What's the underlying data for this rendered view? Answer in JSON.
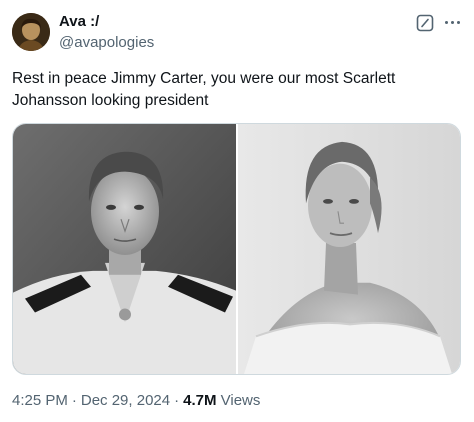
{
  "user": {
    "display_name": "Ava :/",
    "handle": "@avapologies"
  },
  "tweet": {
    "text": "Rest in peace Jimmy Carter, you were our most Scarlett Johansson looking president"
  },
  "meta": {
    "time": "4:25 PM",
    "separator": "·",
    "date": "Dec 29, 2024",
    "view_count": "4.7M",
    "views_label": "Views"
  },
  "icons": {
    "grok": "grok-icon",
    "more": "more-options-icon"
  },
  "colors": {
    "text_primary": "#0f1419",
    "text_secondary": "#536471",
    "border": "#cfd9de"
  }
}
